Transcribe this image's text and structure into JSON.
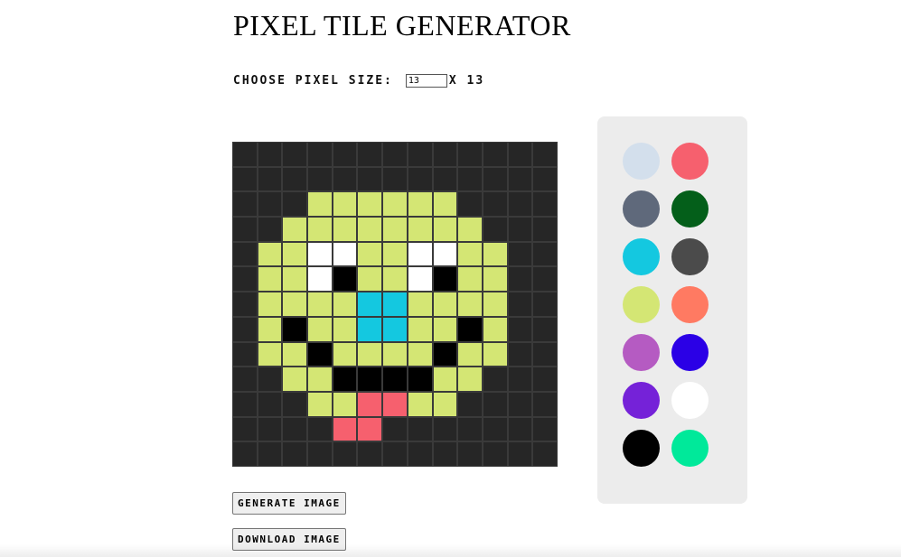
{
  "title": "PIXEL TILE GENERATOR",
  "size_control": {
    "label": "CHOOSE PIXEL SIZE:",
    "value": "13",
    "times_text": "X 13"
  },
  "grid": {
    "size": 13,
    "default_color": "#262626",
    "border_color": "#3a3a3a",
    "palette_key": {
      ".": "#262626",
      "G": "#d4e674",
      "W": "#ffffff",
      "K": "#000000",
      "C": "#14c8e0",
      "R": "#f6606e"
    },
    "rows": [
      ".............",
      ".............",
      "...GGGGGG....",
      "..GGGGGGGG...",
      ".GGWWGGWWGG..",
      ".GGWKGGWKGG..",
      ".GGGGCCGGGG..",
      ".GKGGCCGGKG..",
      ".GGKGGGGKGG..",
      "..GGKKKKGG...",
      "...GGRRGG....",
      "....RR.......",
      "............."
    ]
  },
  "palette": {
    "colors": [
      "#d3dfec",
      "#f6606e",
      "#5f697b",
      "#045f1a",
      "#14c8e0",
      "#4b4b4b",
      "#d4e674",
      "#ff7a62",
      "#b55bc2",
      "#2b00e6",
      "#7522d8",
      "#ffffff",
      "#000000",
      "#00e99a"
    ]
  },
  "buttons": {
    "generate": "GENERATE IMAGE",
    "download": "DOWNLOAD IMAGE"
  }
}
